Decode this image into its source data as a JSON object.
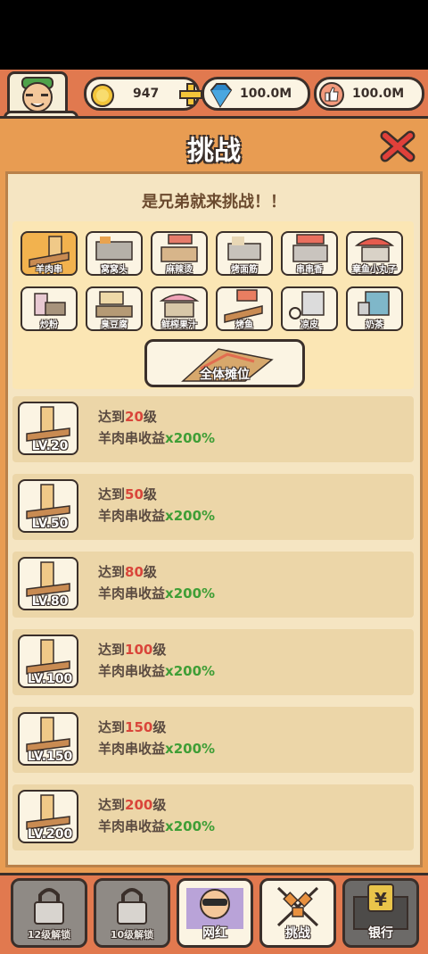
{
  "header": {
    "level": "LV.2",
    "coins": "947",
    "gems": "100.0M",
    "likes": "100.0M"
  },
  "panel": {
    "title": "挑战",
    "subtitle": "是兄弟就来挑战！！"
  },
  "stalls": [
    {
      "label": "羊肉串",
      "active": true
    },
    {
      "label": "窝窝头",
      "active": false
    },
    {
      "label": "麻辣烫",
      "active": false
    },
    {
      "label": "烤面筋",
      "active": false
    },
    {
      "label": "串串香",
      "active": false
    },
    {
      "label": "章鱼小丸子",
      "active": false
    },
    {
      "label": "炒粉",
      "active": false
    },
    {
      "label": "臭豆腐",
      "active": false
    },
    {
      "label": "鲜榨果汁",
      "active": false
    },
    {
      "label": "烤鱼",
      "active": false
    },
    {
      "label": "凉皮",
      "active": false
    },
    {
      "label": "奶茶",
      "active": false
    }
  ],
  "all_stalls_label": "全体摊位",
  "challenges": [
    {
      "badge": "LV.20",
      "prefix": "达到",
      "level": "20",
      "suffix": "级",
      "reward_text": "羊肉串收益",
      "multiplier": "x200%"
    },
    {
      "badge": "LV.50",
      "prefix": "达到",
      "level": "50",
      "suffix": "级",
      "reward_text": "羊肉串收益",
      "multiplier": "x200%"
    },
    {
      "badge": "LV.80",
      "prefix": "达到",
      "level": "80",
      "suffix": "级",
      "reward_text": "羊肉串收益",
      "multiplier": "x200%"
    },
    {
      "badge": "LV.100",
      "prefix": "达到",
      "level": "100",
      "suffix": "级",
      "reward_text": "羊肉串收益",
      "multiplier": "x200%"
    },
    {
      "badge": "LV.150",
      "prefix": "达到",
      "level": "150",
      "suffix": "级",
      "reward_text": "羊肉串收益",
      "multiplier": "x200%"
    },
    {
      "badge": "LV.200",
      "prefix": "达到",
      "level": "200",
      "suffix": "级",
      "reward_text": "羊肉串收益",
      "multiplier": "x200%"
    }
  ],
  "tabs": [
    {
      "label": "12级解锁",
      "locked": true
    },
    {
      "label": "10级解锁",
      "locked": true
    },
    {
      "label": "网红",
      "locked": false
    },
    {
      "label": "挑战",
      "locked": false
    },
    {
      "label": "银行",
      "locked": false
    }
  ],
  "colors": {
    "accent": "#e1794f",
    "panel": "#e89c52",
    "level_red": "#d9453a",
    "bonus_green": "#3f9e36"
  }
}
